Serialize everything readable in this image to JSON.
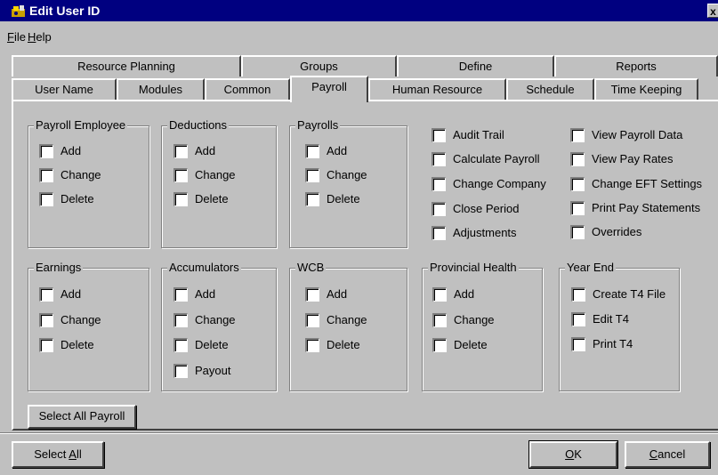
{
  "window": {
    "title": "Edit User ID",
    "close_glyph": "x"
  },
  "menu": [
    {
      "label": "File",
      "mnemonic": "F",
      "rest": "ile"
    },
    {
      "label": "Help",
      "mnemonic": "H",
      "rest": "elp"
    }
  ],
  "tabs_row1": [
    "Resource Planning",
    "Groups",
    "Define",
    "Reports"
  ],
  "tabs_row2": [
    "User Name",
    "Modules",
    "Common",
    "Payroll",
    "Human Resource",
    "Schedule",
    "Time Keeping"
  ],
  "active_tab": "Payroll",
  "groups": {
    "payroll_employee": {
      "title": "Payroll Employee",
      "items": [
        "Add",
        "Change",
        "Delete"
      ]
    },
    "deductions": {
      "title": "Deductions",
      "items": [
        "Add",
        "Change",
        "Delete"
      ]
    },
    "payrolls": {
      "title": "Payrolls",
      "items": [
        "Add",
        "Change",
        "Delete"
      ]
    },
    "earnings": {
      "title": "Earnings",
      "items": [
        "Add",
        "Change",
        "Delete"
      ]
    },
    "accumulators": {
      "title": "Accumulators",
      "items": [
        "Add",
        "Change",
        "Delete",
        "Payout"
      ]
    },
    "wcb": {
      "title": "WCB",
      "items": [
        "Add",
        "Change",
        "Delete"
      ]
    },
    "provincial_health": {
      "title": "Provincial Health",
      "items": [
        "Add",
        "Change",
        "Delete"
      ]
    },
    "year_end": {
      "title": "Year End",
      "items": [
        "Create T4 File",
        "Edit T4",
        "Print T4"
      ]
    }
  },
  "misc_col1": [
    "Audit Trail",
    "Calculate Payroll",
    "Change Company",
    "Close Period",
    "Adjustments"
  ],
  "misc_col2": [
    "View Payroll Data",
    "View Pay Rates",
    "Change EFT Settings",
    "Print Pay Statements",
    "Overrides"
  ],
  "buttons": {
    "select_all_payroll": "Select All Payroll",
    "select_all": {
      "before": "Select ",
      "mnemonic": "A",
      "after": "ll"
    },
    "ok": {
      "mnemonic": "O",
      "after": "K"
    },
    "cancel": {
      "mnemonic": "C",
      "after": "ancel"
    }
  }
}
